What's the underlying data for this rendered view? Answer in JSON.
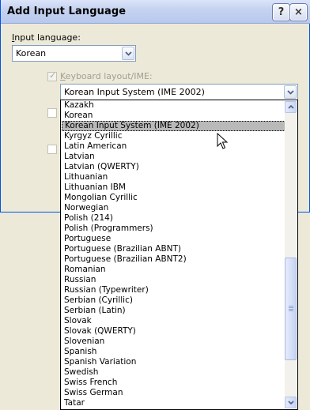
{
  "window": {
    "title": "Add Input Language",
    "help_label": "?",
    "close_label": "×"
  },
  "input_language": {
    "label_prefix": "I",
    "label_rest": "nput language:",
    "value": "Korean"
  },
  "keyboard": {
    "checkbox_checked": true,
    "label_prefix": "K",
    "label_rest": "eyboard layout/IME:",
    "value": "Korean Input System (IME 2002)"
  },
  "layout_list": {
    "selected_index": 2,
    "items": [
      "Kazakh",
      "Korean",
      "Korean Input System (IME 2002)",
      "Kyrgyz Cyrillic",
      "Latin American",
      "Latvian",
      "Latvian (QWERTY)",
      "Lithuanian",
      "Lithuanian IBM",
      "Mongolian Cyrillic",
      "Norwegian",
      "Polish (214)",
      "Polish (Programmers)",
      "Portuguese",
      "Portuguese (Brazilian ABNT)",
      "Portuguese (Brazilian ABNT2)",
      "Romanian",
      "Russian",
      "Russian (Typewriter)",
      "Serbian (Cyrillic)",
      "Serbian (Latin)",
      "Slovak",
      "Slovak (QWERTY)",
      "Slovenian",
      "Spanish",
      "Spanish Variation",
      "Swedish",
      "Swiss French",
      "Swiss German",
      "Tatar"
    ]
  },
  "colors": {
    "dialog_bg": "#ece9d8",
    "selection_bg": "#b9b9b9",
    "field_border": "#7f9db9"
  }
}
